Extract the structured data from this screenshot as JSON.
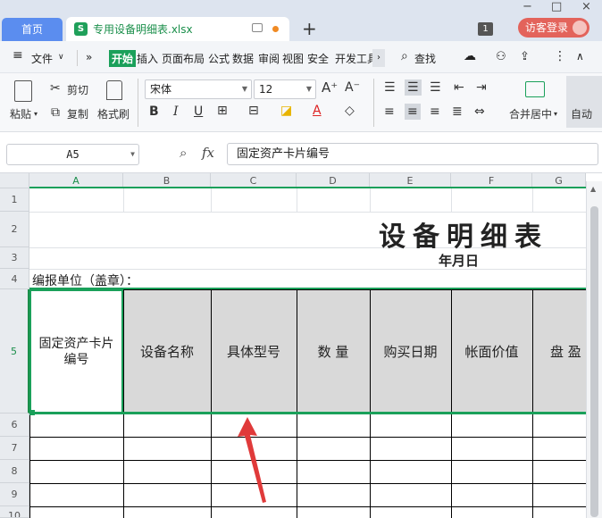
{
  "titlebar": {
    "home_tab": "首页",
    "file_tab": "专用设备明细表.xlsx",
    "new_tab": "+",
    "badge": "1",
    "visitor_login": "访客登录",
    "minimize": "−",
    "maximize": "□",
    "close": "×"
  },
  "menu": {
    "hamburger": "≡",
    "file": "文件",
    "expand": "»",
    "tabs": [
      "开始",
      "插入",
      "页面布局",
      "公式",
      "数据",
      "审阅",
      "视图",
      "安全",
      "开发工具"
    ],
    "search": "查找",
    "more": "⋮",
    "collapse": "∧"
  },
  "ribbon": {
    "paste": "粘贴",
    "cut": "剪切",
    "copy": "复制",
    "format_painter": "格式刷",
    "font_name": "宋体",
    "font_size": "12",
    "bold": "B",
    "italic": "I",
    "underline": "U",
    "merge_center": "合并居中",
    "auto": "自动"
  },
  "formula_bar": {
    "cell_ref": "A5",
    "fx": "fx",
    "content": "固定资产卡片编号"
  },
  "sheet": {
    "columns": [
      "A",
      "B",
      "C",
      "D",
      "E",
      "F",
      "G"
    ],
    "rows": [
      "1",
      "2",
      "3",
      "4",
      "5",
      "6",
      "7",
      "8",
      "9",
      "10"
    ],
    "title": "设备明细表",
    "date": "年月日",
    "unit_label": "编报单位（盖章）：",
    "headers": [
      "固定资产卡片编号",
      "设备名称",
      "具体型号",
      "数 量",
      "购买日期",
      "帐面价值",
      "盘 盈"
    ]
  },
  "colors": {
    "accent_green": "#1aa05a",
    "home_tab_blue": "#5b8def",
    "visitor_red": "#e3635b",
    "header_fill": "#d9d9d9",
    "arrow_red": "#e03a3a"
  }
}
